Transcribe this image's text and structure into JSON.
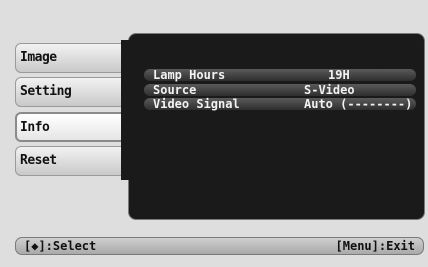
{
  "menu": {
    "items": [
      {
        "label": "Image"
      },
      {
        "label": "Setting"
      },
      {
        "label": "Info"
      },
      {
        "label": "Reset"
      }
    ],
    "selected": "Info"
  },
  "info": {
    "rows": [
      {
        "label": "Lamp Hours",
        "value": "19H"
      },
      {
        "label": "Source",
        "value": "S-Video"
      },
      {
        "label": "Video Signal",
        "value": "Auto (--------)"
      }
    ]
  },
  "statusbar": {
    "select_hint": "[◆]:Select",
    "exit_hint": "[Menu]:Exit"
  }
}
